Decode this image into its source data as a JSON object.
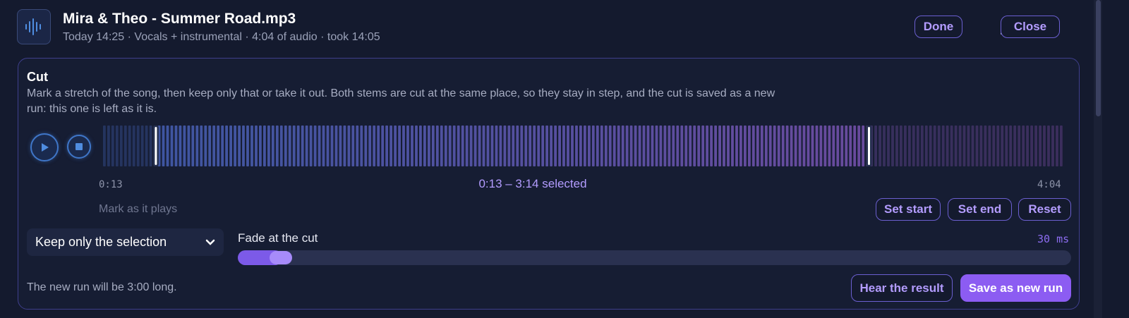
{
  "header": {
    "title": "Mira & Theo - Summer Road.mp3",
    "subtitle": "Today 14:25 · Vocals + instrumental · 4:04 of audio · took 14:05",
    "done_label": "Done",
    "close_label": "Close"
  },
  "cut": {
    "title": "Cut",
    "description": "Mark a stretch of the song, then keep only that or take it out. Both stems are cut at the same place, so they stay in step, and the cut is saved as a new run: this one is left as it is.",
    "time_start": "0:13",
    "time_end": "4:04",
    "selection_text": "0:13 – 3:14 selected",
    "mark_label": "Mark as it plays",
    "set_start_label": "Set start",
    "set_end_label": "Set end",
    "reset_label": "Reset",
    "mode": "Keep only the selection",
    "fade_label": "Fade at the cut",
    "fade_value": "30 ms",
    "fade_fraction": 0.04,
    "duration_note": "The new run will be 3:00 long.",
    "hear_label": "Hear the result",
    "save_label": "Save as new run",
    "selection_fraction": [
      0.055,
      0.797
    ]
  },
  "colors": {
    "accent": "#8c5cf2",
    "accent_text": "#b39cff",
    "wave_start": "#3d5aa8",
    "wave_end": "#7a4aa2"
  }
}
